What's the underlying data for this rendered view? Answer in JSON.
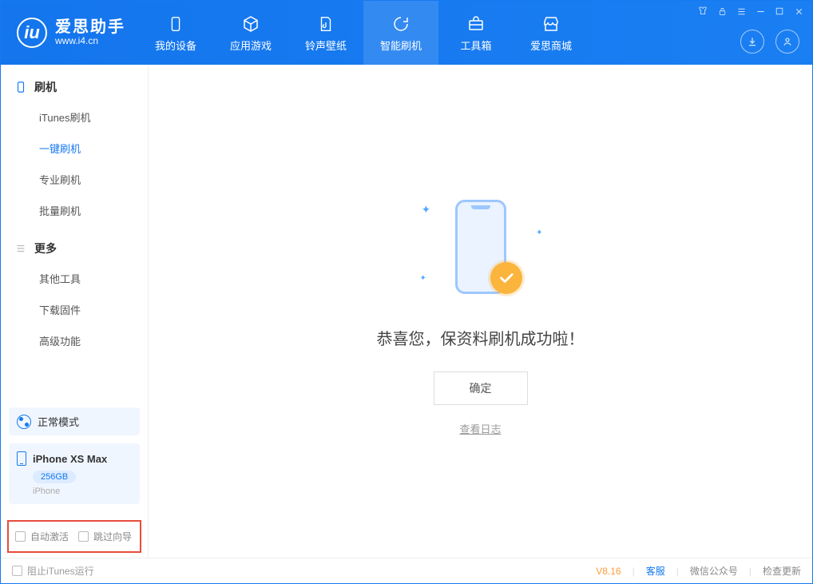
{
  "app": {
    "name": "爱思助手",
    "domain": "www.i4.cn"
  },
  "nav": {
    "my_device": "我的设备",
    "apps_games": "应用游戏",
    "ringtones_wallpapers": "铃声壁纸",
    "smart_flash": "智能刷机",
    "toolbox": "工具箱",
    "store": "爱思商城"
  },
  "sidebar": {
    "group_flash": "刷机",
    "group_more": "更多",
    "items": {
      "itunes_flash": "iTunes刷机",
      "one_click_flash": "一键刷机",
      "pro_flash": "专业刷机",
      "batch_flash": "批量刷机",
      "other_tools": "其他工具",
      "download_firmware": "下载固件",
      "advanced": "高级功能"
    },
    "mode": "正常模式",
    "device": {
      "name": "iPhone XS Max",
      "capacity": "256GB",
      "model": "iPhone"
    },
    "check_auto_activate": "自动激活",
    "check_skip_guide": "跳过向导"
  },
  "main": {
    "success_message": "恭喜您，保资料刷机成功啦！",
    "confirm": "确定",
    "view_log": "查看日志"
  },
  "footer": {
    "block_itunes": "阻止iTunes运行",
    "version": "V8.16",
    "support": "客服",
    "wechat": "微信公众号",
    "check_update": "检查更新"
  }
}
